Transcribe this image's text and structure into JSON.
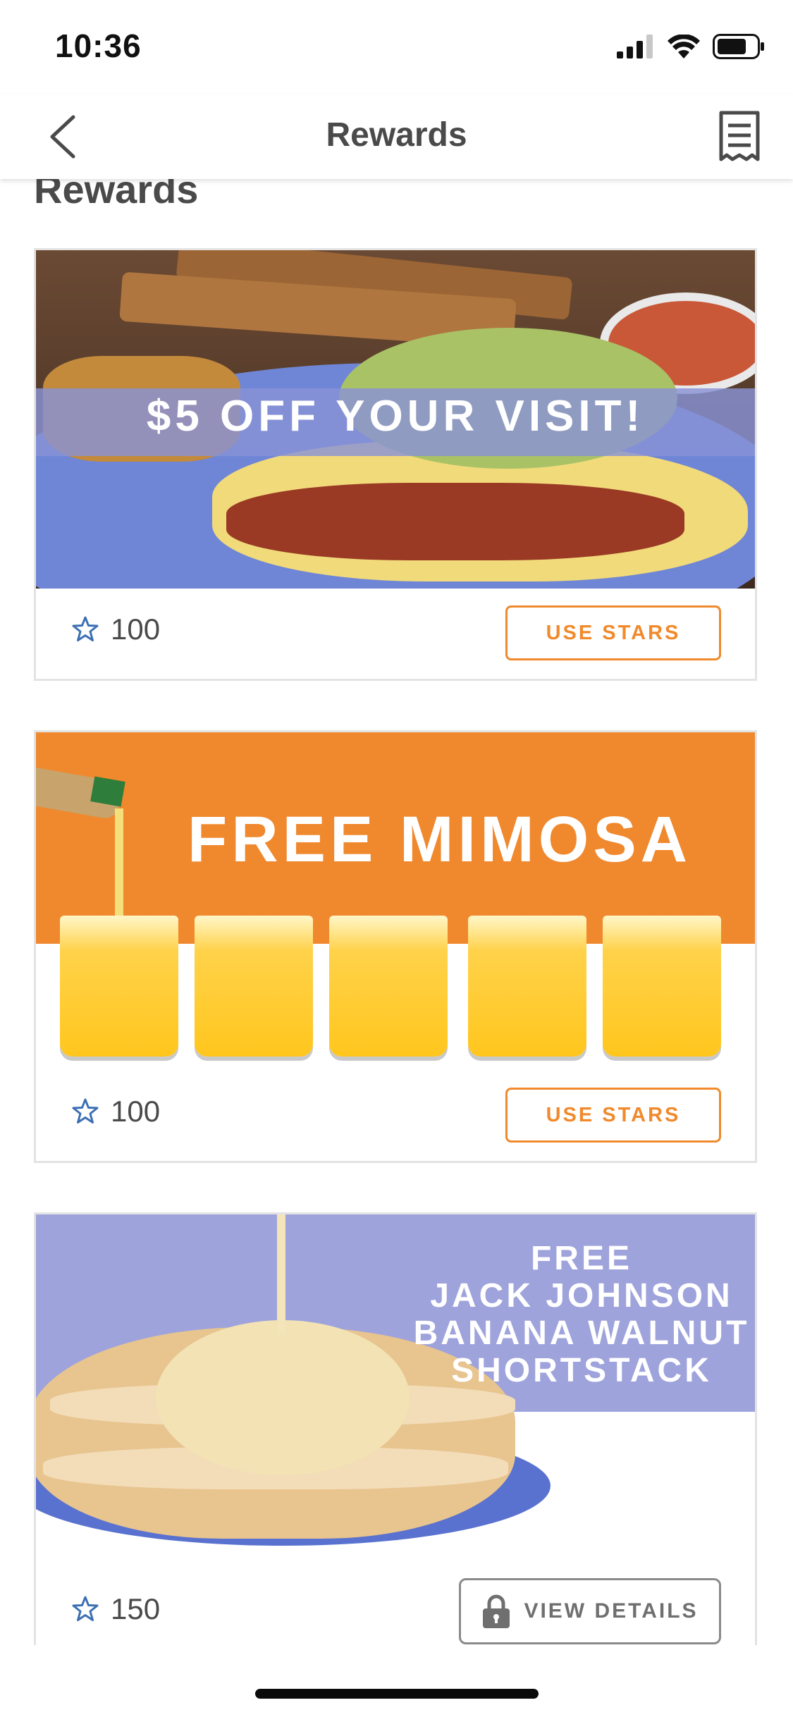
{
  "status_bar": {
    "time": "10:36"
  },
  "nav": {
    "title": "Rewards"
  },
  "section": {
    "title": "Rewards"
  },
  "rewards": [
    {
      "banner_text": "$5 OFF YOUR VISIT!",
      "points": "100",
      "button": "USE STARS"
    },
    {
      "banner_text": "FREE MIMOSA",
      "points": "100",
      "button": "USE STARS"
    },
    {
      "banner_lines": [
        "FREE",
        "JACK JOHNSON",
        "BANANA WALNUT",
        "SHORTSTACK"
      ],
      "points": "150",
      "button": "VIEW DETAILS"
    }
  ],
  "colors": {
    "accent": "#f08a2c",
    "star": "#3b6fb3",
    "banner_purple": "#9ea3dc"
  },
  "icons": [
    "back-chevron-icon",
    "receipt-icon",
    "star-icon",
    "lock-icon",
    "signal-icon",
    "wifi-icon",
    "battery-icon"
  ]
}
